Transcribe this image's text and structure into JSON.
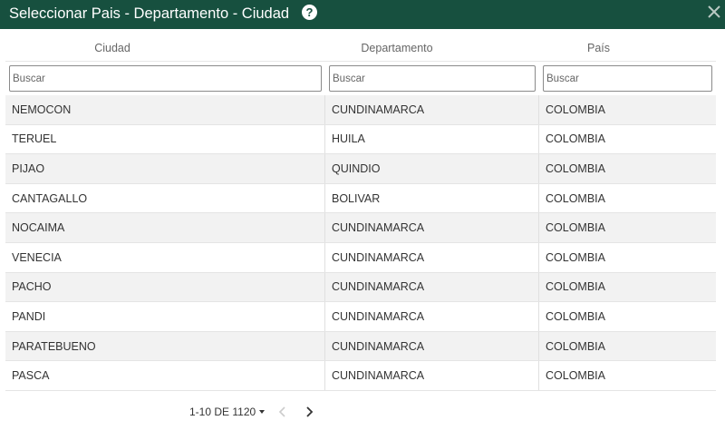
{
  "dialog": {
    "title": "Seleccionar Pais - Departamento - Ciudad",
    "help_icon": "question-circle-icon",
    "help_symbol": "?",
    "close_icon": "close-x-icon"
  },
  "columns": {
    "city": "Ciudad",
    "department": "Departamento",
    "country": "País"
  },
  "filters": {
    "city_placeholder": "Buscar",
    "department_placeholder": "Buscar",
    "country_placeholder": "Buscar"
  },
  "rows": [
    {
      "city": "NEMOCON",
      "department": "CUNDINAMARCA",
      "country": "COLOMBIA"
    },
    {
      "city": "TERUEL",
      "department": "HUILA",
      "country": "COLOMBIA"
    },
    {
      "city": "PIJAO",
      "department": "QUINDIO",
      "country": "COLOMBIA"
    },
    {
      "city": "CANTAGALLO",
      "department": "BOLIVAR",
      "country": "COLOMBIA"
    },
    {
      "city": "NOCAIMA",
      "department": "CUNDINAMARCA",
      "country": "COLOMBIA"
    },
    {
      "city": "VENECIA",
      "department": "CUNDINAMARCA",
      "country": "COLOMBIA"
    },
    {
      "city": "PACHO",
      "department": "CUNDINAMARCA",
      "country": "COLOMBIA"
    },
    {
      "city": "PANDI",
      "department": "CUNDINAMARCA",
      "country": "COLOMBIA"
    },
    {
      "city": "PARATEBUENO",
      "department": "CUNDINAMARCA",
      "country": "COLOMBIA"
    },
    {
      "city": "PASCA",
      "department": "CUNDINAMARCA",
      "country": "COLOMBIA"
    }
  ],
  "pagination": {
    "range_label": "1-10 DE 1120",
    "prev_icon": "chevron-left-icon",
    "next_icon": "chevron-right-icon",
    "prev_enabled": false,
    "next_enabled": true
  },
  "colors": {
    "header_bg": "#17503f",
    "row_alt_bg": "#f2f2f2"
  }
}
